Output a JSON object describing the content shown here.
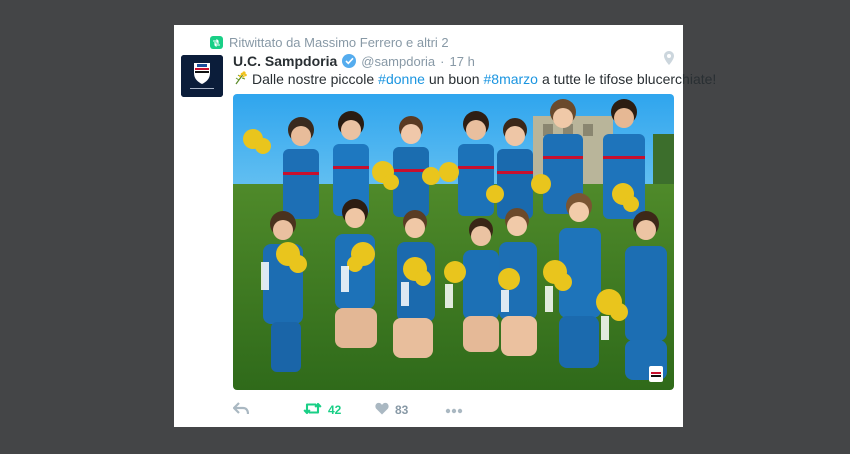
{
  "tweet": {
    "retweet_context": "Ritwittato da Massimo Ferrero e altri 2",
    "author_name": "U.C. Sampdoria",
    "handle": "@sampdoria",
    "separator": "·",
    "time": "17 h",
    "text": {
      "part1": "Dalle nostre piccole",
      "hashtag1": "#donne",
      "part2": "un buon",
      "hashtag2": "#8marzo",
      "part3": "a tutte le tifose blucerchiate!"
    },
    "retweet_count": "42",
    "like_count": "83"
  },
  "colors": {
    "page_background": "#444547",
    "card_background": "#ffffff",
    "hashtag": "#1b95e0",
    "retweet_green": "#19cf86",
    "muted_gray": "#8899a6",
    "verified_blue": "#55acee"
  },
  "icons": {
    "retweet_context": "retweet-icon",
    "location": "location-pin-icon",
    "verified": "verified-badge-icon",
    "mimosa": "mimosa-flower-emoji",
    "reply": "reply-icon",
    "retweet": "retweet-icon",
    "like": "heart-icon",
    "more": "more-dots-icon"
  }
}
